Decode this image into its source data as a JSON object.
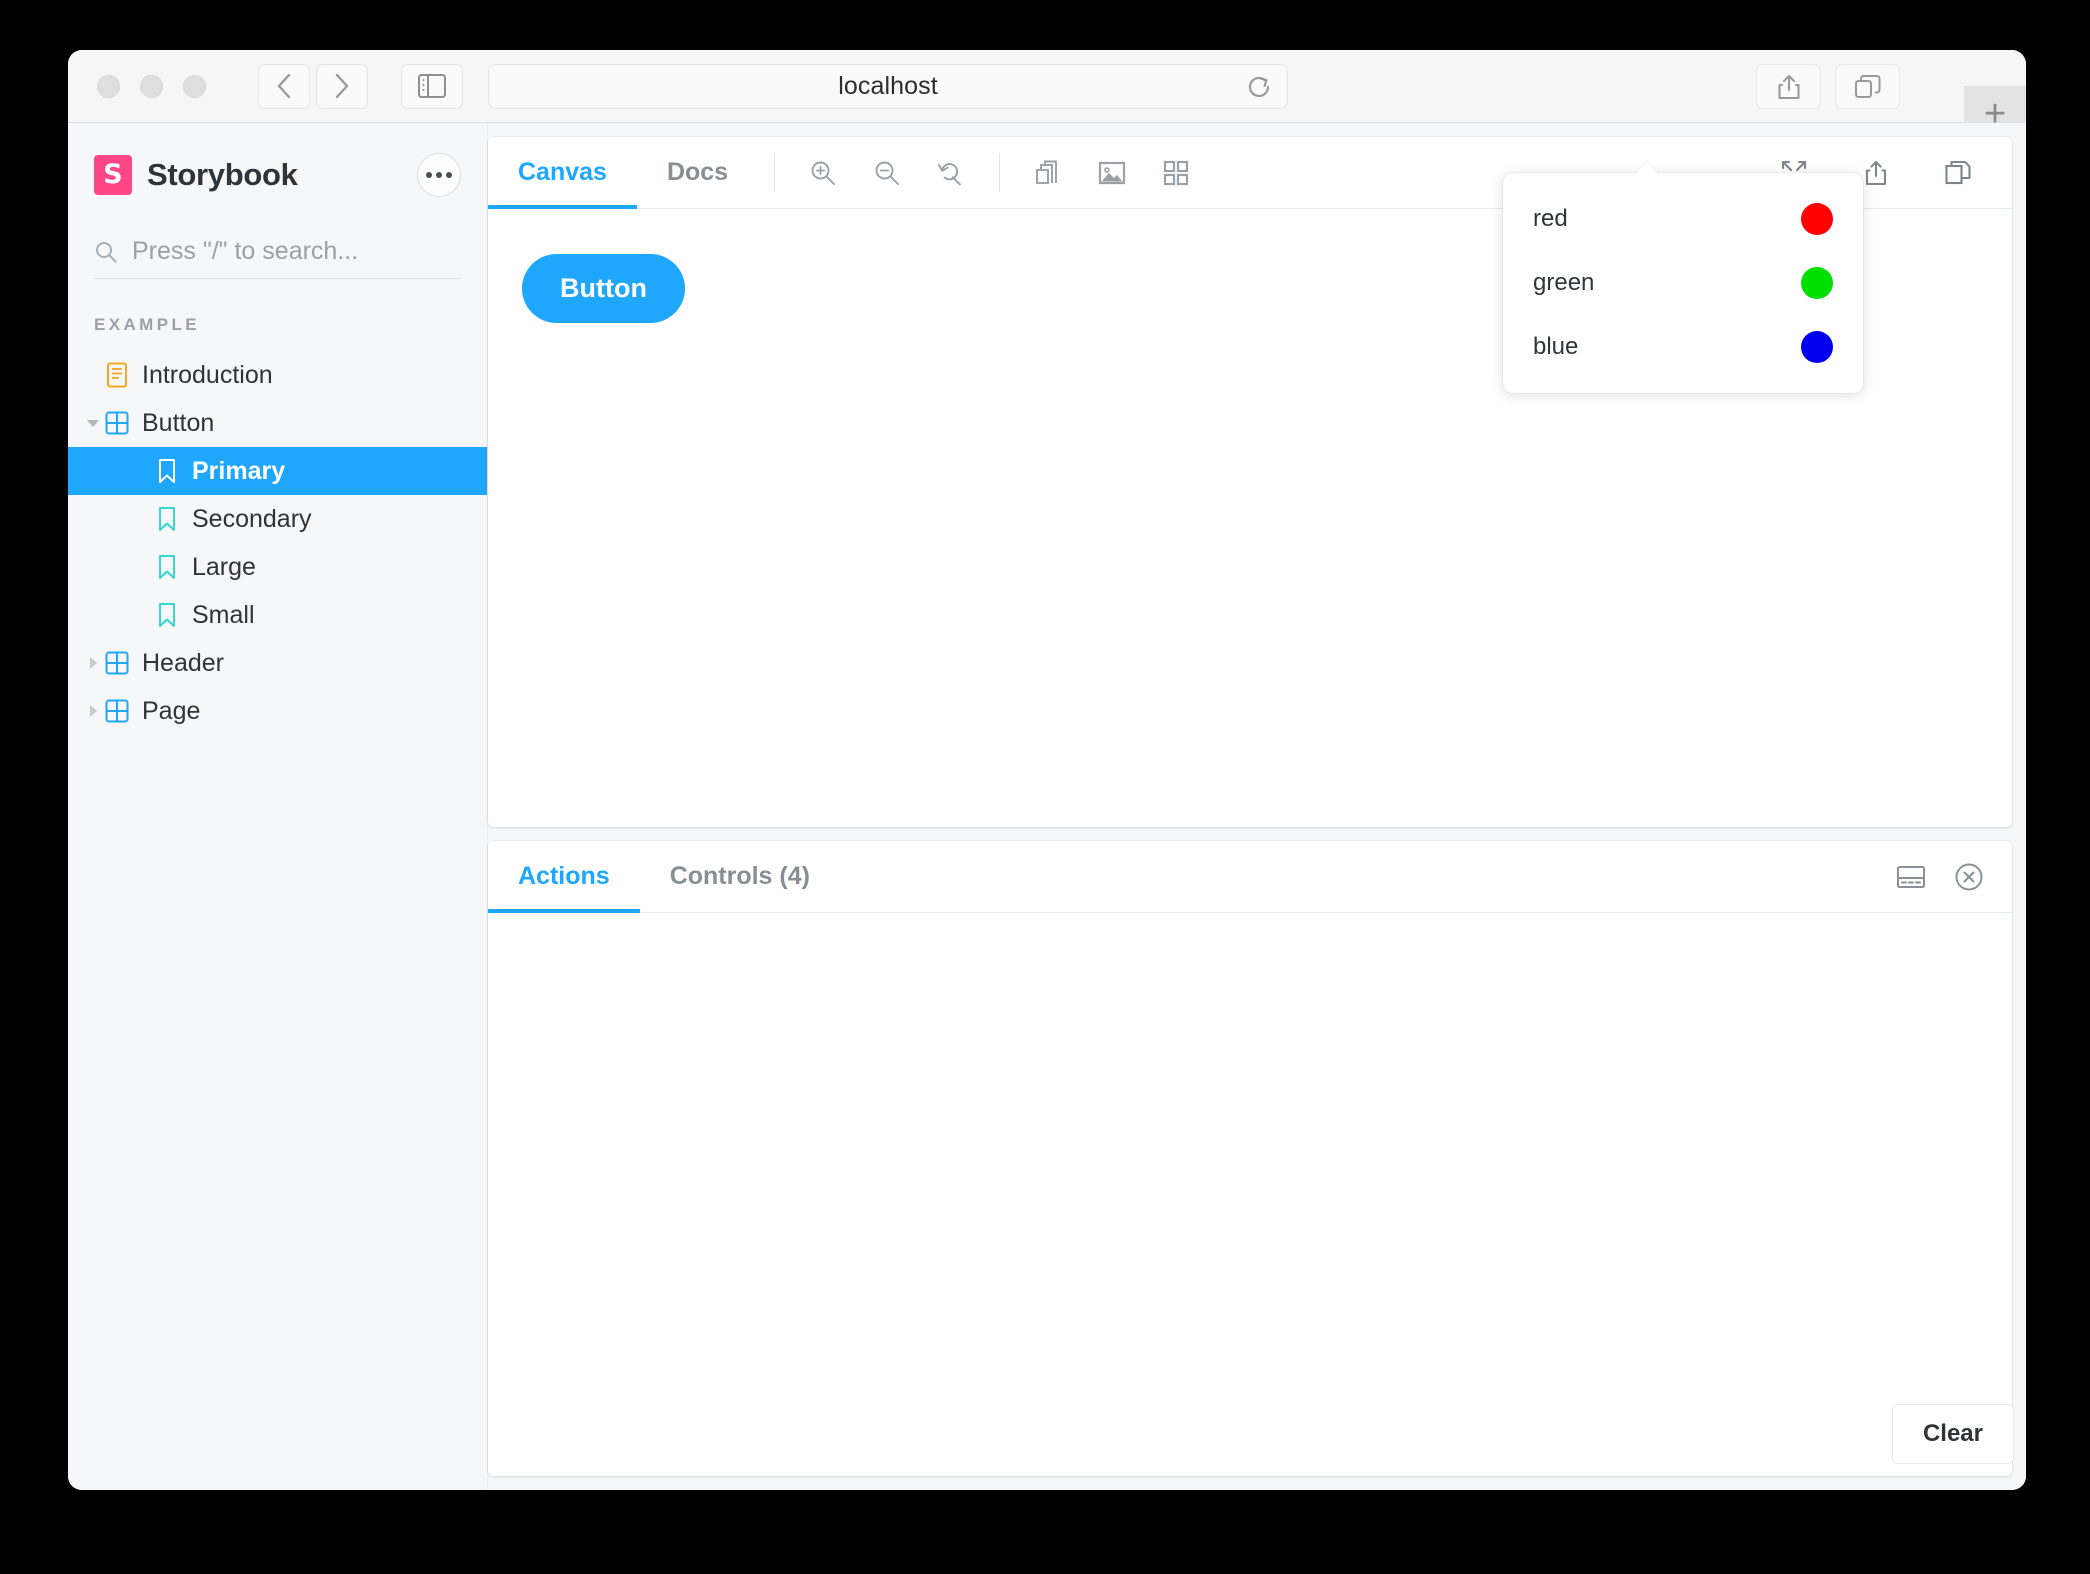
{
  "browser": {
    "url": "localhost",
    "traffic_lights": [
      "close-button",
      "minimize-button",
      "maximize-button"
    ],
    "back_label": "Back",
    "forward_label": "Forward",
    "sidebar_toggle_label": "Show Sidebar",
    "reload_label": "Reload",
    "share_label": "Share",
    "tab_overview_label": "Tab Overview",
    "new_tab_label": "+"
  },
  "sidebar": {
    "brand": "Storybook",
    "logo_letter": "S",
    "logo_color": "#ff4785",
    "menu_button_label": "…",
    "search_placeholder": "Press \"/\" to search...",
    "heading": "EXAMPLE",
    "items": [
      {
        "label": "Introduction",
        "icon": "document-icon",
        "level": 0,
        "expandable": false,
        "expanded": false,
        "selected": false,
        "icon_color": "#f6a623"
      },
      {
        "label": "Button",
        "icon": "component-icon",
        "level": 0,
        "expandable": true,
        "expanded": true,
        "selected": false,
        "icon_color": "#1ea7fd"
      },
      {
        "label": "Primary",
        "icon": "story-icon",
        "level": 1,
        "expandable": false,
        "expanded": false,
        "selected": true,
        "icon_color": "#ffffff"
      },
      {
        "label": "Secondary",
        "icon": "story-icon",
        "level": 1,
        "expandable": false,
        "expanded": false,
        "selected": false,
        "icon_color": "#37d5d3"
      },
      {
        "label": "Large",
        "icon": "story-icon",
        "level": 1,
        "expandable": false,
        "expanded": false,
        "selected": false,
        "icon_color": "#37d5d3"
      },
      {
        "label": "Small",
        "icon": "story-icon",
        "level": 1,
        "expandable": false,
        "expanded": false,
        "selected": false,
        "icon_color": "#37d5d3"
      },
      {
        "label": "Header",
        "icon": "component-icon",
        "level": 0,
        "expandable": true,
        "expanded": false,
        "selected": false,
        "icon_color": "#1ea7fd"
      },
      {
        "label": "Page",
        "icon": "component-icon",
        "level": 0,
        "expandable": true,
        "expanded": false,
        "selected": false,
        "icon_color": "#1ea7fd"
      }
    ]
  },
  "canvas_toolbar": {
    "tabs": [
      {
        "label": "Canvas",
        "active": true
      },
      {
        "label": "Docs",
        "active": false
      }
    ],
    "tools": [
      "zoom-in-icon",
      "zoom-out-icon",
      "zoom-reset-icon",
      "viewport-icon",
      "backgrounds-icon",
      "grid-icon"
    ],
    "right_tools": [
      "fullscreen-icon",
      "share-icon",
      "open-new-tab-icon"
    ]
  },
  "story": {
    "button_label": "Button",
    "button_color": "#1ea7fd"
  },
  "backgrounds_tooltip": {
    "visible": true,
    "options": [
      {
        "label": "red",
        "color": "#ff0000"
      },
      {
        "label": "green",
        "color": "#00e000"
      },
      {
        "label": "blue",
        "color": "#0000ee"
      }
    ]
  },
  "addons_panel": {
    "tabs": [
      {
        "label": "Actions",
        "active": true
      },
      {
        "label": "Controls (4)",
        "active": false
      }
    ],
    "right_tools": [
      "panel-position-icon",
      "close-panel-icon"
    ],
    "clear_label": "Clear",
    "log_entries": []
  }
}
